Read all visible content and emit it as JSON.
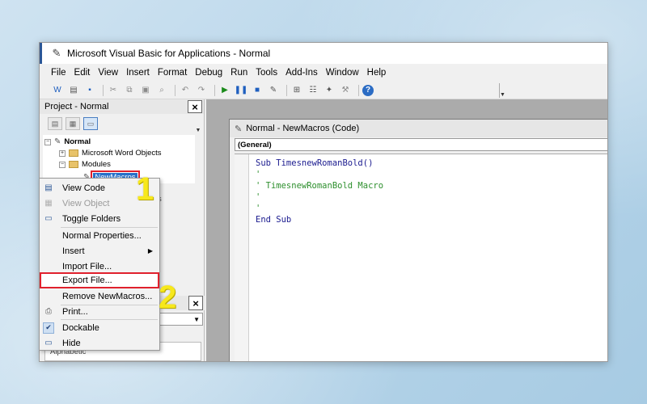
{
  "window": {
    "title": "Microsoft Visual Basic for Applications - Normal"
  },
  "menu": [
    "File",
    "Edit",
    "View",
    "Insert",
    "Format",
    "Debug",
    "Run",
    "Tools",
    "Add-Ins",
    "Window",
    "Help"
  ],
  "toolbar": {
    "icons": [
      "word-icon",
      "insert-module-icon",
      "save-icon",
      "cut-icon",
      "copy-icon",
      "paste-icon",
      "find-icon",
      "undo-icon",
      "redo-icon",
      "run-icon",
      "break-icon",
      "reset-icon",
      "design-mode-icon",
      "project-explorer-icon",
      "properties-icon",
      "object-browser-icon",
      "toolbox-icon",
      "help-icon"
    ]
  },
  "project_pane": {
    "title": "Project - Normal",
    "close_glyph": "×",
    "tree": {
      "root": "Normal",
      "word_objects": "Microsoft Word Objects",
      "modules": "Modules",
      "selected_module": "NewMacros",
      "partial_text": "s"
    }
  },
  "properties_pane": {
    "close_glyph": "×",
    "partial_text": "Alphabetic"
  },
  "code_window": {
    "title": "Normal - NewMacros (Code)",
    "general_dropdown": "(General)",
    "lines": [
      {
        "text": "Sub TimesnewRomanBold()",
        "kind": "keyword"
      },
      {
        "text": "'",
        "kind": "comment"
      },
      {
        "text": "' TimesnewRomanBold Macro",
        "kind": "comment"
      },
      {
        "text": "'",
        "kind": "comment"
      },
      {
        "text": "'",
        "kind": "comment"
      },
      {
        "text": "End Sub",
        "kind": "keyword"
      }
    ]
  },
  "context_menu": {
    "items": [
      {
        "label": "View Code",
        "icon": "view-code-icon",
        "disabled": false,
        "highlight": false
      },
      {
        "label": "View Object",
        "icon": "view-object-icon",
        "disabled": true,
        "highlight": false
      },
      {
        "label": "Toggle Folders",
        "icon": "folder-icon",
        "disabled": false,
        "highlight": false
      },
      {
        "label": "Normal Properties...",
        "icon": "",
        "disabled": false,
        "highlight": false
      },
      {
        "label": "Insert",
        "icon": "",
        "disabled": false,
        "highlight": false,
        "submenu": true
      },
      {
        "label": "Import File...",
        "icon": "",
        "disabled": false,
        "highlight": false
      },
      {
        "label": "Export File...",
        "icon": "",
        "disabled": false,
        "highlight": true
      },
      {
        "label": "Remove NewMacros...",
        "icon": "",
        "disabled": false,
        "highlight": false
      },
      {
        "label": "Print...",
        "icon": "print-icon",
        "disabled": false,
        "highlight": false
      },
      {
        "label": "Dockable",
        "icon": "check-icon",
        "disabled": false,
        "highlight": false
      },
      {
        "label": "Hide",
        "icon": "hide-icon",
        "disabled": false,
        "highlight": false
      }
    ],
    "submenu_arrow": "▶"
  },
  "annotations": {
    "step1": "1",
    "step2": "2"
  },
  "colors": {
    "accent": "#2870c9",
    "highlight_outline": "#e0212d",
    "step_number": "#f7e81c",
    "comment": "#2d8f2d",
    "keyword": "#1b1b8f"
  }
}
